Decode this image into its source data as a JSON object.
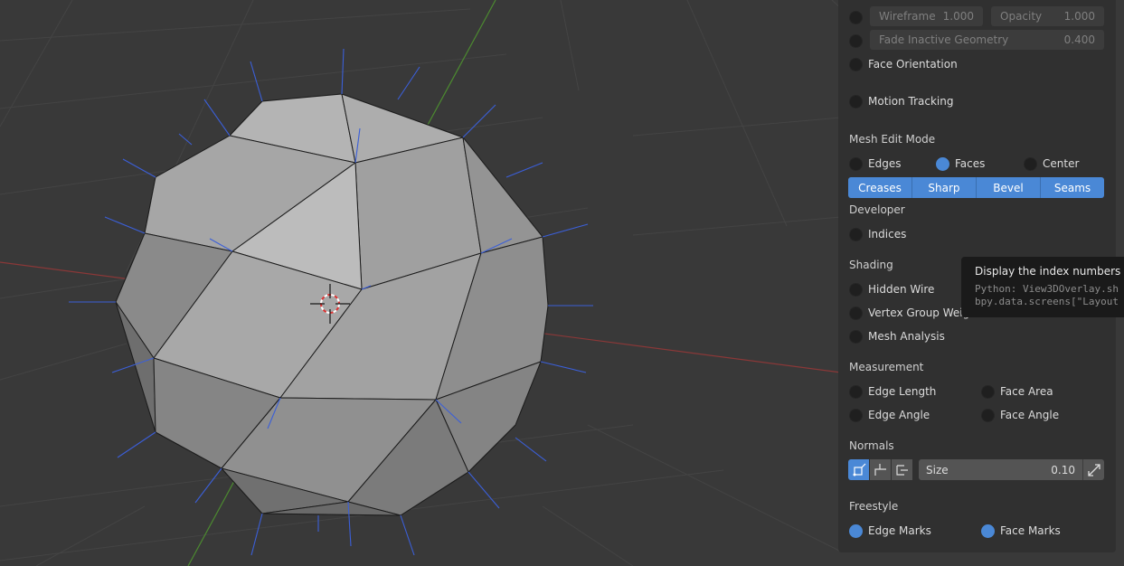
{
  "overlay": {
    "wireframe_label": "Wireframe",
    "wireframe_value": "1.000",
    "opacity_label": "Opacity",
    "opacity_value": "1.000",
    "fade_label": "Fade Inactive Geometry",
    "fade_value": "0.400",
    "face_orientation": "Face Orientation",
    "motion_tracking": "Motion Tracking"
  },
  "mesh_edit_mode": {
    "title": "Mesh Edit Mode",
    "edges": "Edges",
    "faces": "Faces",
    "center": "Center",
    "buttons": [
      "Creases",
      "Sharp",
      "Bevel",
      "Seams"
    ]
  },
  "developer": {
    "title": "Developer",
    "indices": "Indices"
  },
  "shading": {
    "title": "Shading",
    "hidden_wire": "Hidden Wire",
    "vertex_group": "Vertex Group Weig",
    "mesh_analysis": "Mesh Analysis"
  },
  "measurement": {
    "title": "Measurement",
    "edge_length": "Edge Length",
    "face_area": "Face Area",
    "edge_angle": "Edge Angle",
    "face_angle": "Face Angle"
  },
  "normals": {
    "title": "Normals",
    "size_label": "Size",
    "size_value": "0.10"
  },
  "freestyle": {
    "title": "Freestyle",
    "edge_marks": "Edge Marks",
    "face_marks": "Face Marks"
  },
  "tooltip": {
    "title": "Display the index numbers of",
    "python1": "Python: View3DOverlay.sh",
    "python2": "bpy.data.screens[\"Layout"
  },
  "colors": {
    "accent": "#4a88d6",
    "panel": "#303030",
    "viewport": "#393939"
  }
}
